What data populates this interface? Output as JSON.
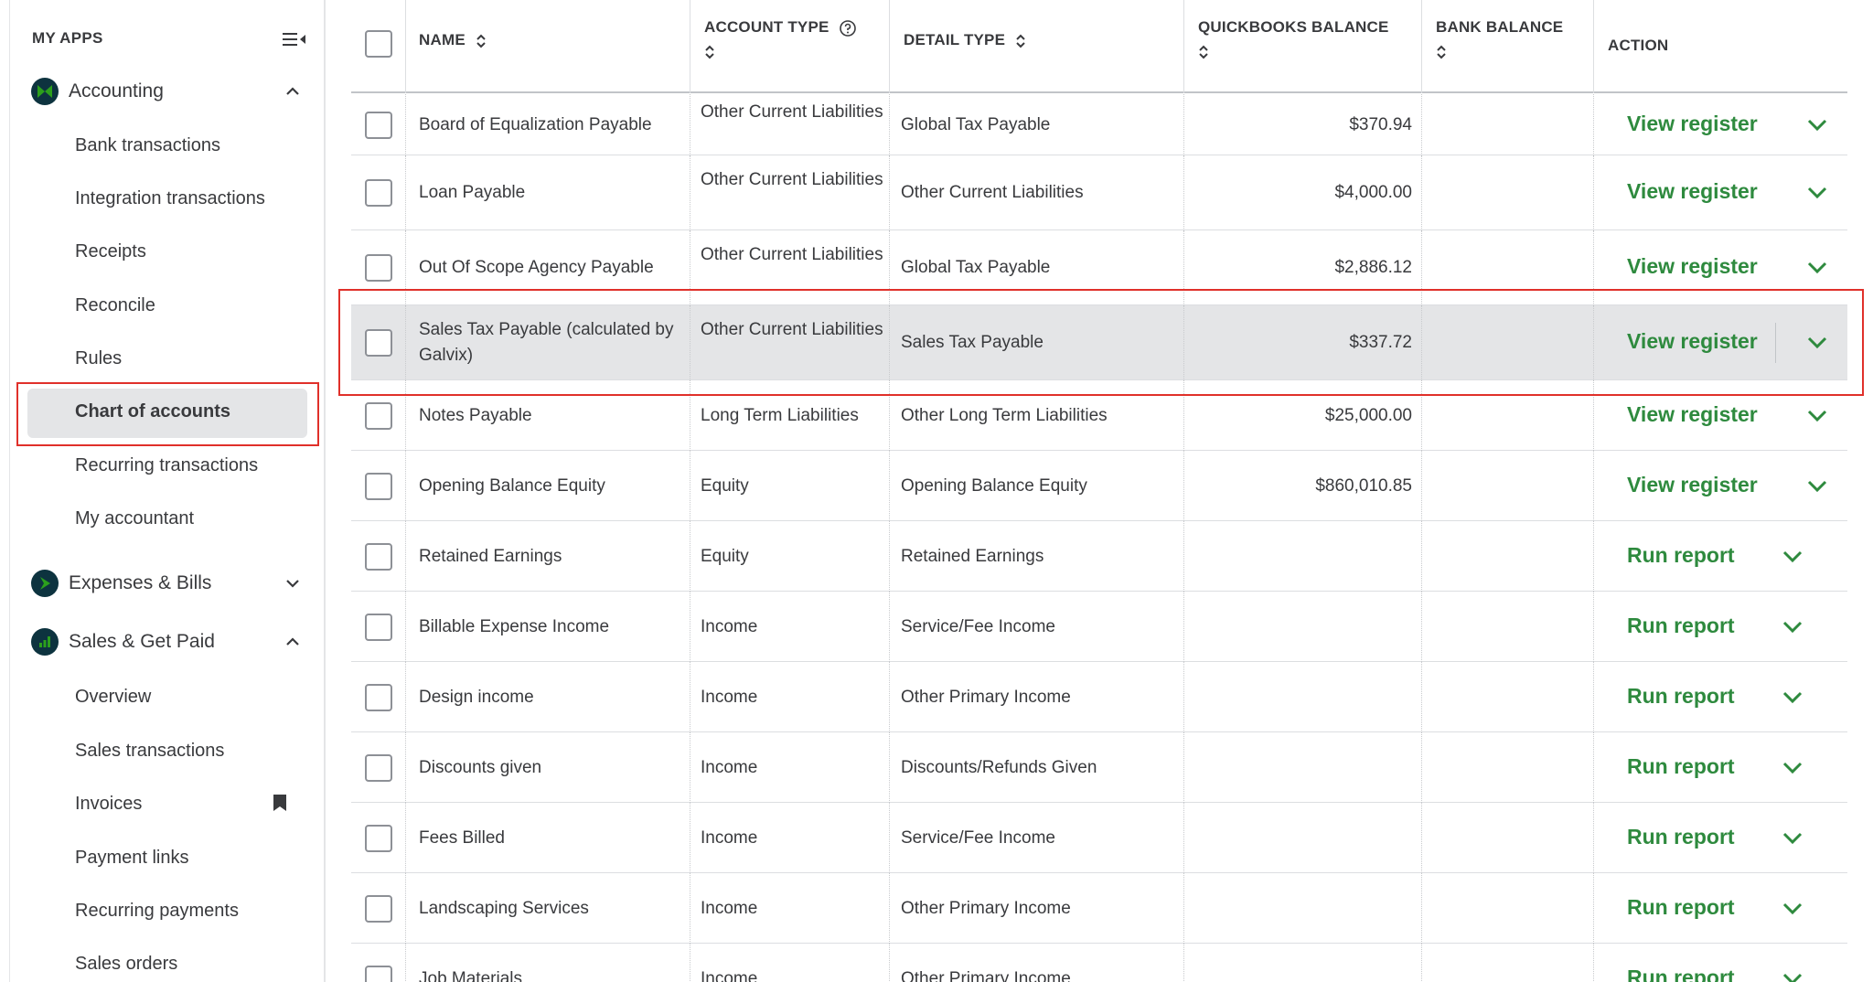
{
  "sidebar": {
    "title": "MY APPS",
    "apps": [
      {
        "label": "Accounting",
        "expanded": true
      },
      {
        "label": "Expenses & Bills",
        "expanded": false
      },
      {
        "label": "Sales & Get Paid",
        "expanded": true
      }
    ],
    "accounting_items": [
      "Bank transactions",
      "Integration transactions",
      "Receipts",
      "Reconcile",
      "Rules",
      "Chart of accounts",
      "Recurring transactions",
      "My accountant"
    ],
    "sales_items": [
      "Overview",
      "Sales transactions",
      "Invoices",
      "Payment links",
      "Recurring payments",
      "Sales orders"
    ],
    "active_item": "Chart of accounts"
  },
  "table": {
    "headers": {
      "name": "NAME",
      "account_type": "ACCOUNT TYPE",
      "detail_type": "DETAIL TYPE",
      "qb_balance": "QUICKBOOKS BALANCE",
      "bank_balance": "BANK BALANCE",
      "action": "ACTION"
    },
    "rows": [
      {
        "name": "Board of Equalization Payable",
        "account_type": "Other Current Liabilities",
        "detail_type": "Global Tax Payable",
        "qb_balance": "$370.94",
        "action": "View register"
      },
      {
        "name": "Loan Payable",
        "account_type": "Other Current Liabilities",
        "detail_type": "Other Current Liabilities",
        "qb_balance": "$4,000.00",
        "action": "View register"
      },
      {
        "name": "Out Of Scope Agency Payable",
        "account_type": "Other Current Liabilities",
        "detail_type": "Global Tax Payable",
        "qb_balance": "$2,886.12",
        "action": "View register"
      },
      {
        "name": "Sales Tax Payable (calculated by Galvix)",
        "account_type": "Other Current Liabilities",
        "detail_type": "Sales Tax Payable",
        "qb_balance": "$337.72",
        "action": "View register"
      },
      {
        "name": "Notes Payable",
        "account_type": "Long Term Liabilities",
        "detail_type": "Other Long Term Liabilities",
        "qb_balance": "$25,000.00",
        "action": "View register"
      },
      {
        "name": "Opening Balance Equity",
        "account_type": "Equity",
        "detail_type": "Opening Balance Equity",
        "qb_balance": "$860,010.85",
        "action": "View register"
      },
      {
        "name": "Retained Earnings",
        "account_type": "Equity",
        "detail_type": "Retained Earnings",
        "qb_balance": "",
        "action": "Run report"
      },
      {
        "name": "Billable Expense Income",
        "account_type": "Income",
        "detail_type": "Service/Fee Income",
        "qb_balance": "",
        "action": "Run report"
      },
      {
        "name": "Design income",
        "account_type": "Income",
        "detail_type": "Other Primary Income",
        "qb_balance": "",
        "action": "Run report"
      },
      {
        "name": "Discounts given",
        "account_type": "Income",
        "detail_type": "Discounts/Refunds Given",
        "qb_balance": "",
        "action": "Run report"
      },
      {
        "name": "Fees Billed",
        "account_type": "Income",
        "detail_type": "Service/Fee Income",
        "qb_balance": "",
        "action": "Run report"
      },
      {
        "name": "Landscaping Services",
        "account_type": "Income",
        "detail_type": "Other Primary Income",
        "qb_balance": "",
        "action": "Run report"
      },
      {
        "name": "Job Materials",
        "account_type": "Income",
        "detail_type": "Other Primary Income",
        "qb_balance": "",
        "action": "Run report"
      }
    ]
  },
  "colors": {
    "accent_green": "#2e8a3e",
    "highlight_red": "#e0302a",
    "logo_navy": "#0d333f",
    "logo_green": "#2ca01c"
  }
}
